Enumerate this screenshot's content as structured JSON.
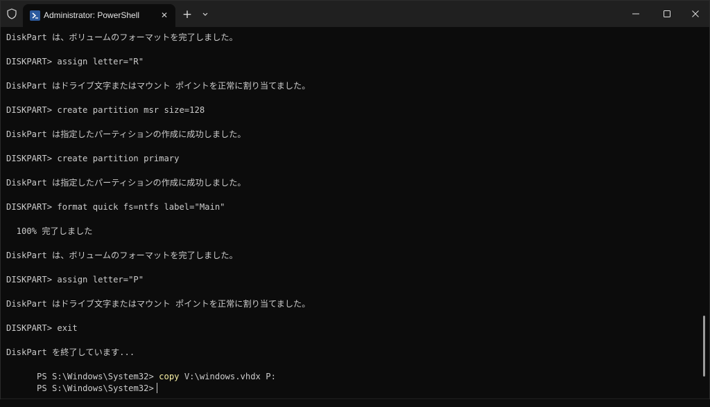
{
  "window": {
    "tab_title": "Administrator: PowerShell",
    "new_tab_symbol": "+",
    "close_tab_symbol": "✕",
    "icons": [
      "shield-icon",
      "powershell-icon",
      "plus-icon",
      "chevron-down-icon",
      "minimize-icon",
      "maximize-icon",
      "close-icon"
    ]
  },
  "terminal": {
    "lines": [
      "DiskPart は、ボリュームのフォーマットを完了しました。",
      "DISKPART> assign letter=\"R\"",
      "DiskPart はドライブ文字またはマウント ポイントを正常に割り当てました。",
      "DISKPART> create partition msr size=128",
      "DiskPart は指定したパーティションの作成に成功しました。",
      "DISKPART> create partition primary",
      "DiskPart は指定したパーティションの作成に成功しました。",
      "DISKPART> format quick fs=ntfs label=\"Main\"",
      "  100% 完了しました",
      "DiskPart は、ボリュームのフォーマットを完了しました。",
      "DISKPART> assign letter=\"P\"",
      "DiskPart はドライブ文字またはマウント ポイントを正常に割り当てました。",
      "DISKPART> exit",
      "DiskPart を終了しています...",
      {
        "prompt": "PS S:\\Windows\\System32> ",
        "command": "copy",
        "args": " V:\\windows.vhdx P:"
      },
      "PS S:\\Windows\\System32>"
    ]
  },
  "colors": {
    "background": "#0c0c0c",
    "titlebar": "#202020",
    "text": "#cccccc",
    "command": "#f9f1a5"
  }
}
